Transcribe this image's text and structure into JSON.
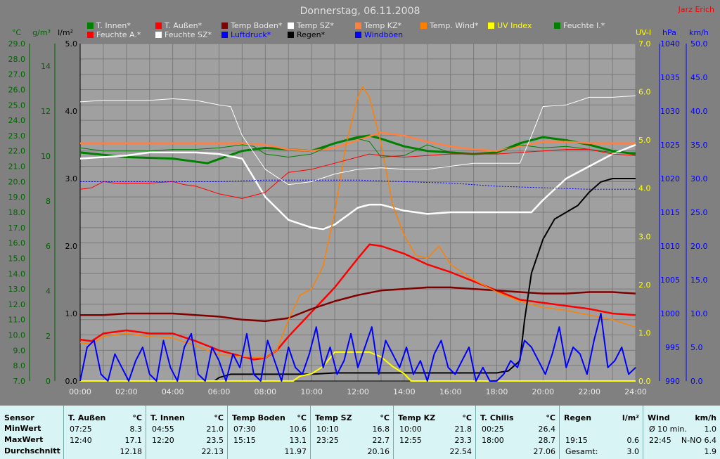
{
  "title": "Donnerstag, 06.11.2008",
  "author": "Jarz Erich",
  "colors": {
    "background": "#808080",
    "plot": "#a0a0a0",
    "grid": "#787878"
  },
  "axes": {
    "temp": {
      "unit": "°C",
      "ticks": [
        "29.0",
        "28.0",
        "27.0",
        "26.0",
        "25.0",
        "24.0",
        "23.0",
        "22.0",
        "21.0",
        "20.0",
        "19.0",
        "18.0",
        "17.0",
        "16.0",
        "15.0",
        "14.0",
        "13.0",
        "12.0",
        "11.0",
        "10.0",
        "9.0",
        "8.0",
        "7.0"
      ],
      "range": [
        7,
        29
      ],
      "color": "#006400"
    },
    "humidity": {
      "unit": "g/m³",
      "ticks": [
        "14",
        "12",
        "10",
        "8",
        "6",
        "4",
        "2",
        "0"
      ],
      "range": [
        0,
        15
      ],
      "color": "#006400"
    },
    "rain": {
      "unit": "l/m²",
      "ticks": [
        "5.0",
        "4.0",
        "3.0",
        "2.0",
        "1.0",
        "0.0"
      ],
      "range": [
        0,
        5
      ],
      "color": "#000000"
    },
    "uv": {
      "unit": "UV-I",
      "ticks": [
        "7.0",
        "6.0",
        "5.0",
        "4.0",
        "3.0",
        "2.0",
        "1.0",
        "0.0"
      ],
      "range": [
        0,
        7
      ],
      "color": "#ffff00"
    },
    "pressure": {
      "unit": "hPa",
      "ticks": [
        "1040",
        "1035",
        "1030",
        "1025",
        "1020",
        "1015",
        "1010",
        "1005",
        "1000",
        "995",
        "990"
      ],
      "range": [
        990,
        1040
      ],
      "color": "#0000ff"
    },
    "wind": {
      "unit": "km/h",
      "ticks": [
        "50.0",
        "45.0",
        "40.0",
        "35.0",
        "30.0",
        "25.0",
        "20.0",
        "15.0",
        "10.0",
        "5.0",
        "0.0"
      ],
      "range": [
        0,
        50
      ],
      "color": "#0000ff"
    },
    "time": {
      "ticks": [
        "00:00",
        "02:00",
        "04:00",
        "06:00",
        "08:00",
        "10:00",
        "12:00",
        "14:00",
        "16:00",
        "18:00",
        "20:00",
        "22:00",
        "24:00"
      ],
      "range": [
        0,
        24
      ]
    }
  },
  "legend": [
    {
      "label": "T. Innen*",
      "color": "#008000"
    },
    {
      "label": "T. Außen*",
      "color": "#ff0000"
    },
    {
      "label": "Temp Boden*",
      "color": "#800000"
    },
    {
      "label": "Temp SZ*",
      "color": "#ffffff"
    },
    {
      "label": "Temp KZ*",
      "color": "#ff8040"
    },
    {
      "label": "Temp. Wind*",
      "color": "#ff8000"
    },
    {
      "label": "UV Index",
      "color": "#ffff00"
    },
    {
      "label": "Feuchte I.*",
      "color": "#008000"
    },
    {
      "label": "Feuchte A.*",
      "color": "#ff0000"
    },
    {
      "label": "Feuchte SZ*",
      "color": "#ffffff"
    },
    {
      "label": "Luftdruck*",
      "color": "#0000ff"
    },
    {
      "label": "Regen*",
      "color": "#000000"
    },
    {
      "label": "Windböen",
      "color": "#0000ff"
    }
  ],
  "chart_data": {
    "type": "line",
    "title": "Donnerstag, 06.11.2008",
    "xlabel": "",
    "xlim": [
      0,
      24
    ],
    "series": [
      {
        "name": "T. Innen*",
        "axis": "temp",
        "color": "#008000",
        "width": 3,
        "x": [
          0,
          2,
          4,
          5.5,
          7,
          8,
          9,
          10,
          11,
          12,
          12.5,
          13,
          14,
          15,
          16,
          17,
          18,
          19,
          20,
          21,
          22,
          23,
          24
        ],
        "y": [
          21.9,
          21.6,
          21.5,
          21.2,
          22.0,
          22.2,
          22.1,
          22.0,
          22.5,
          22.9,
          23.0,
          22.8,
          22.3,
          22.0,
          21.9,
          21.8,
          21.9,
          22.5,
          22.9,
          22.7,
          22.4,
          22.0,
          21.8
        ]
      },
      {
        "name": "T. Außen*",
        "axis": "temp",
        "color": "#ff0000",
        "width": 2.5,
        "x": [
          0,
          0.5,
          1,
          2,
          3,
          4,
          5,
          6,
          7,
          7.5,
          8,
          8.5,
          9,
          10,
          11,
          12,
          12.5,
          13,
          14,
          15,
          16,
          17,
          18,
          19,
          20,
          21,
          22,
          23,
          24
        ],
        "y": [
          9.7,
          9.6,
          10.1,
          10.3,
          10.1,
          10.1,
          9.6,
          9.0,
          8.6,
          8.4,
          8.5,
          9.0,
          9.9,
          11.5,
          13.1,
          15.0,
          15.9,
          15.8,
          15.3,
          14.6,
          14.1,
          13.5,
          12.9,
          12.3,
          12.1,
          11.9,
          11.7,
          11.4,
          11.3
        ]
      },
      {
        "name": "Temp Boden*",
        "axis": "temp",
        "color": "#800000",
        "width": 2.5,
        "x": [
          0,
          1,
          2,
          3,
          4,
          5,
          6,
          7,
          8,
          9,
          10,
          11,
          12,
          13,
          14,
          15,
          16,
          17,
          18,
          19,
          20,
          21,
          22,
          23,
          24
        ],
        "y": [
          11.3,
          11.3,
          11.4,
          11.4,
          11.4,
          11.3,
          11.2,
          11.0,
          10.9,
          11.1,
          11.7,
          12.2,
          12.6,
          12.9,
          13.0,
          13.1,
          13.1,
          13.0,
          12.9,
          12.8,
          12.7,
          12.7,
          12.8,
          12.8,
          12.7
        ]
      },
      {
        "name": "Temp SZ*",
        "axis": "temp",
        "color": "#ffffff",
        "width": 2.5,
        "x": [
          0,
          1,
          2,
          3,
          4,
          5,
          6,
          7,
          8,
          9,
          10,
          10.5,
          11,
          12,
          12.5,
          13,
          14,
          15,
          16,
          17,
          18,
          19,
          19.5,
          20,
          21,
          22,
          23,
          24
        ],
        "y": [
          21.5,
          21.6,
          21.7,
          21.9,
          21.9,
          21.9,
          21.8,
          21.5,
          19.0,
          17.5,
          17.0,
          16.9,
          17.2,
          18.3,
          18.5,
          18.5,
          18.1,
          17.9,
          18.0,
          18.0,
          18.0,
          18.0,
          18.0,
          18.8,
          20.2,
          21.0,
          21.8,
          22.4
        ]
      },
      {
        "name": "Temp KZ*",
        "axis": "temp",
        "color": "#ff8040",
        "width": 2.5,
        "x": [
          0,
          1,
          2,
          3,
          4,
          5,
          6,
          7,
          8,
          9,
          10,
          11,
          12,
          13,
          14,
          15,
          16,
          17,
          18,
          19,
          20,
          21,
          22,
          23,
          24
        ],
        "y": [
          22.5,
          22.5,
          22.5,
          22.5,
          22.5,
          22.5,
          22.5,
          22.5,
          22.4,
          22.1,
          22.0,
          22.2,
          22.7,
          23.2,
          23.0,
          22.6,
          22.3,
          22.1,
          22.0,
          22.3,
          22.6,
          22.6,
          22.5,
          22.5,
          22.5
        ]
      },
      {
        "name": "Temp. Wind*",
        "axis": "temp",
        "color": "#ff8000",
        "width": 1.5,
        "x": [
          0,
          0.5,
          1,
          2,
          3,
          4,
          5,
          6,
          7,
          8,
          8.5,
          9,
          9.5,
          10,
          10.5,
          11,
          11.5,
          12,
          12.2,
          12.5,
          13,
          13.5,
          14,
          14.5,
          15,
          15.5,
          16,
          17,
          18,
          19,
          20,
          21,
          22,
          23,
          24
        ],
        "y": [
          9.5,
          9.4,
          9.9,
          10.1,
          9.9,
          9.8,
          9.3,
          8.7,
          8.6,
          8.5,
          9.0,
          11.0,
          12.6,
          13.0,
          14.5,
          18.0,
          22.5,
          25.5,
          26.2,
          25.5,
          22.5,
          18.5,
          16.5,
          15.2,
          15.0,
          15.8,
          14.6,
          13.6,
          12.8,
          12.2,
          11.8,
          11.6,
          11.3,
          11.0,
          10.5
        ]
      },
      {
        "name": "Feuchte I.*",
        "axis": "temp",
        "color": "#008000",
        "width": 1,
        "x": [
          0,
          1,
          2,
          3,
          4,
          5,
          6,
          7,
          7.5,
          8,
          9,
          10,
          11,
          12,
          12.5,
          13,
          14,
          15,
          16,
          17,
          18,
          19,
          20,
          21,
          22,
          23,
          24
        ],
        "y": [
          22.2,
          22.0,
          22.0,
          22.0,
          22.1,
          22.1,
          22.2,
          22.4,
          22.3,
          21.8,
          21.6,
          21.8,
          22.5,
          22.8,
          22.6,
          21.6,
          21.7,
          22.4,
          21.9,
          21.8,
          21.9,
          22.4,
          22.2,
          22.3,
          22.1,
          21.9,
          21.9
        ]
      },
      {
        "name": "Feuchte A.*",
        "axis": "temp",
        "color": "#ff0000",
        "width": 1,
        "x": [
          0,
          0.5,
          1,
          1.5,
          2,
          3,
          4,
          4.5,
          5,
          6,
          7,
          8,
          9,
          10,
          11,
          12,
          12.5,
          13,
          14,
          15,
          16,
          17,
          18,
          19,
          20,
          21,
          22,
          23,
          24
        ],
        "y": [
          19.5,
          19.6,
          20.0,
          19.9,
          19.9,
          19.9,
          20.0,
          19.8,
          19.7,
          19.2,
          18.9,
          19.3,
          20.6,
          20.8,
          21.2,
          21.6,
          21.8,
          21.7,
          21.6,
          21.7,
          21.8,
          21.8,
          21.8,
          21.9,
          22.0,
          22.1,
          22.1,
          21.8,
          21.7
        ]
      },
      {
        "name": "Feuchte SZ*",
        "axis": "temp",
        "color": "#ffffff",
        "width": 1,
        "x": [
          0,
          1,
          2,
          3,
          4,
          5,
          6,
          6.5,
          7,
          8,
          9,
          10,
          11,
          12,
          13,
          14,
          15,
          16,
          17,
          18,
          19,
          19.5,
          20,
          21,
          22,
          23,
          24
        ],
        "y": [
          25.2,
          25.3,
          25.3,
          25.3,
          25.4,
          25.3,
          25.0,
          24.9,
          23.0,
          20.8,
          19.8,
          20.0,
          20.5,
          20.8,
          20.9,
          20.8,
          20.8,
          21.0,
          21.2,
          21.2,
          21.2,
          23.0,
          24.9,
          25.0,
          25.5,
          25.5,
          25.6
        ]
      },
      {
        "name": "Luftdruck*",
        "axis": "temp",
        "color": "#0000ff",
        "width": 1,
        "dash": "2,2",
        "x": [
          0,
          2,
          4,
          6,
          8,
          10,
          12,
          14,
          16,
          18,
          20,
          22,
          24
        ],
        "y": [
          20.0,
          20.0,
          20.0,
          20.0,
          20.1,
          20.1,
          20.1,
          20.0,
          19.9,
          19.7,
          19.6,
          19.5,
          19.5
        ]
      },
      {
        "name": "Regen*",
        "axis": "rain",
        "color": "#000000",
        "width": 2,
        "x": [
          0,
          5.8,
          6,
          6.5,
          7,
          8,
          9,
          10,
          11,
          12,
          13,
          14,
          15,
          16,
          17,
          18,
          18.5,
          19,
          19.2,
          19.5,
          20,
          20.5,
          21,
          21.5,
          22,
          22.5,
          23,
          23.5,
          24
        ],
        "y": [
          0,
          0,
          0.05,
          0.1,
          0.1,
          0.1,
          0.1,
          0.1,
          0.12,
          0.12,
          0.12,
          0.12,
          0.12,
          0.12,
          0.12,
          0.12,
          0.15,
          0.3,
          0.9,
          1.6,
          2.1,
          2.4,
          2.5,
          2.6,
          2.8,
          2.95,
          3.0,
          3.0,
          3.0
        ]
      },
      {
        "name": "UV Index",
        "axis": "uv",
        "color": "#ffff00",
        "width": 2,
        "x": [
          0,
          9.2,
          9.5,
          10,
          10.5,
          11,
          11.5,
          12,
          12.5,
          13,
          13.5,
          14,
          14.3,
          24
        ],
        "y": [
          0,
          0,
          0.1,
          0.15,
          0.3,
          0.6,
          0.6,
          0.6,
          0.6,
          0.5,
          0.3,
          0.15,
          0,
          0
        ]
      },
      {
        "name": "Windböen",
        "axis": "wind",
        "color": "#0000ff",
        "width": 2,
        "x": [
          0,
          0.3,
          0.6,
          0.9,
          1.2,
          1.5,
          1.8,
          2.1,
          2.4,
          2.7,
          3.0,
          3.3,
          3.6,
          3.9,
          4.2,
          4.5,
          4.8,
          5.1,
          5.4,
          5.7,
          6.0,
          6.3,
          6.6,
          6.9,
          7.2,
          7.5,
          7.8,
          8.1,
          8.4,
          8.7,
          9.0,
          9.3,
          9.6,
          9.9,
          10.2,
          10.5,
          10.8,
          11.1,
          11.4,
          11.7,
          12.0,
          12.3,
          12.6,
          12.9,
          13.2,
          13.5,
          13.8,
          14.1,
          14.4,
          14.7,
          15.0,
          15.3,
          15.6,
          15.9,
          16.2,
          16.5,
          16.8,
          17.1,
          17.4,
          17.7,
          18.0,
          18.3,
          18.6,
          18.9,
          19.2,
          19.5,
          19.8,
          20.1,
          20.4,
          20.7,
          21.0,
          21.3,
          21.6,
          21.9,
          22.2,
          22.5,
          22.8,
          23.1,
          23.4,
          23.7,
          24.0
        ],
        "y": [
          0,
          5,
          6,
          1,
          0,
          4,
          2,
          0,
          3,
          5,
          1,
          0,
          6,
          2,
          0,
          5,
          7,
          1,
          0,
          5,
          3,
          0,
          4,
          2,
          7,
          1,
          0,
          6,
          3,
          0,
          5,
          2,
          1,
          4,
          8,
          2,
          5,
          1,
          3,
          7,
          2,
          5,
          8,
          1,
          6,
          4,
          2,
          5,
          1,
          3,
          0,
          4,
          6,
          2,
          1,
          3,
          5,
          0,
          2,
          0,
          0,
          1,
          3,
          2,
          6,
          5,
          3,
          1,
          4,
          8,
          2,
          5,
          4,
          1,
          6,
          10,
          2,
          3,
          5,
          1,
          2
        ]
      }
    ]
  },
  "stats": {
    "row_labels": {
      "sensor": "Sensor",
      "min": "MinWert",
      "max": "MaxWert",
      "avg": "Durchschnitt"
    },
    "columns": [
      {
        "name": "T. Außen",
        "unit": "°C",
        "min_time": "07:25",
        "min_val": "8.3",
        "max_time": "12:40",
        "max_val": "17.1",
        "avg": "12.18"
      },
      {
        "name": "T. Innen",
        "unit": "°C",
        "min_time": "04:55",
        "min_val": "21.0",
        "max_time": "12:20",
        "max_val": "23.5",
        "avg": "22.13"
      },
      {
        "name": "Temp Boden",
        "unit": "°C",
        "min_time": "07:30",
        "min_val": "10.6",
        "max_time": "15:15",
        "max_val": "13.1",
        "avg": "11.97"
      },
      {
        "name": "Temp SZ",
        "unit": "°C",
        "min_time": "10:10",
        "min_val": "16.8",
        "max_time": "23:25",
        "max_val": "22.7",
        "avg": "20.16"
      },
      {
        "name": "Temp KZ",
        "unit": "°C",
        "min_time": "10:00",
        "min_val": "21.8",
        "max_time": "12:55",
        "max_val": "23.3",
        "avg": "22.54"
      },
      {
        "name": "T. Chilis",
        "unit": "°C",
        "min_time": "00:25",
        "min_val": "26.4",
        "max_time": "18:00",
        "max_val": "28.7",
        "avg": "27.06"
      },
      {
        "name": "Regen",
        "unit": "l/m²",
        "min_time": "",
        "min_val": "",
        "max_time": "19:15",
        "max_val": "0.6",
        "avg_label": "Gesamt:",
        "avg": "3.0"
      },
      {
        "name": "Wind",
        "unit": "km/h",
        "min_time": "Ø 10 min.",
        "min_val": "1.0",
        "max_time": "22:45",
        "max_val": "N-NO 6.4",
        "avg": "1.9"
      }
    ]
  }
}
